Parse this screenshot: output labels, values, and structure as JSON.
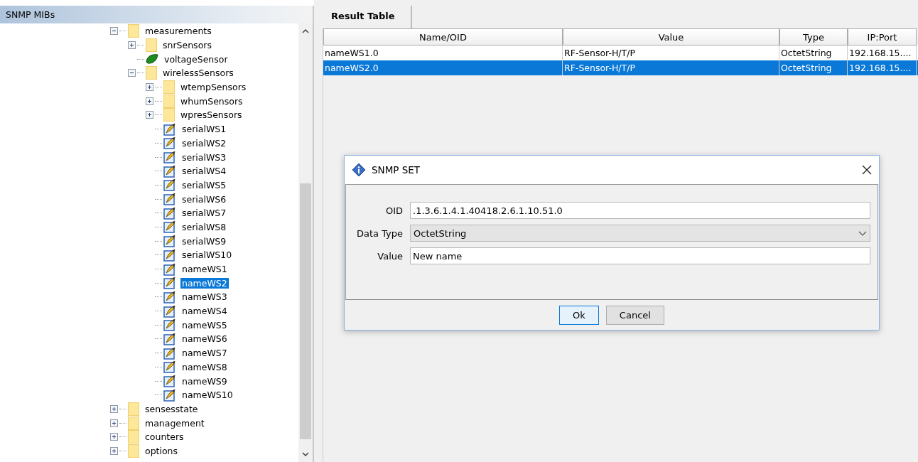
{
  "left_panel": {
    "title": "SNMP MIBs"
  },
  "tree": [
    {
      "label": "measurements",
      "kind": "folder",
      "expanded": true,
      "selected": false,
      "children": [
        {
          "label": "snrSensors",
          "kind": "folder",
          "expanded": false,
          "selected": false
        },
        {
          "label": "voltageSensor",
          "kind": "leaf",
          "selected": false
        },
        {
          "label": "wirelessSensors",
          "kind": "folder",
          "expanded": true,
          "selected": false,
          "children": [
            {
              "label": "wtempSensors",
              "kind": "folder",
              "expanded": false,
              "selected": false
            },
            {
              "label": "whumSensors",
              "kind": "folder",
              "expanded": false,
              "selected": false
            },
            {
              "label": "wpresSensors",
              "kind": "folder",
              "expanded": false,
              "selected": false
            },
            {
              "label": "serialWS1",
              "kind": "scalar",
              "selected": false
            },
            {
              "label": "serialWS2",
              "kind": "scalar",
              "selected": false
            },
            {
              "label": "serialWS3",
              "kind": "scalar",
              "selected": false
            },
            {
              "label": "serialWS4",
              "kind": "scalar",
              "selected": false
            },
            {
              "label": "serialWS5",
              "kind": "scalar",
              "selected": false
            },
            {
              "label": "serialWS6",
              "kind": "scalar",
              "selected": false
            },
            {
              "label": "serialWS7",
              "kind": "scalar",
              "selected": false
            },
            {
              "label": "serialWS8",
              "kind": "scalar",
              "selected": false
            },
            {
              "label": "serialWS9",
              "kind": "scalar",
              "selected": false
            },
            {
              "label": "serialWS10",
              "kind": "scalar",
              "selected": false
            },
            {
              "label": "nameWS1",
              "kind": "scalar",
              "selected": false
            },
            {
              "label": "nameWS2",
              "kind": "scalar",
              "selected": true
            },
            {
              "label": "nameWS3",
              "kind": "scalar",
              "selected": false
            },
            {
              "label": "nameWS4",
              "kind": "scalar",
              "selected": false
            },
            {
              "label": "nameWS5",
              "kind": "scalar",
              "selected": false
            },
            {
              "label": "nameWS6",
              "kind": "scalar",
              "selected": false
            },
            {
              "label": "nameWS7",
              "kind": "scalar",
              "selected": false
            },
            {
              "label": "nameWS8",
              "kind": "scalar",
              "selected": false
            },
            {
              "label": "nameWS9",
              "kind": "scalar",
              "selected": false
            },
            {
              "label": "nameWS10",
              "kind": "scalar",
              "selected": false
            }
          ]
        }
      ]
    },
    {
      "label": "sensesstate",
      "kind": "folder",
      "expanded": false,
      "selected": false
    },
    {
      "label": "management",
      "kind": "folder",
      "expanded": false,
      "selected": false
    },
    {
      "label": "counters",
      "kind": "folder",
      "expanded": false,
      "selected": false
    },
    {
      "label": "options",
      "kind": "folder",
      "expanded": false,
      "selected": false
    }
  ],
  "tabs": [
    {
      "label": "Result Table",
      "selected": true
    }
  ],
  "table": {
    "columns": [
      "Name/OID",
      "Value",
      "Type",
      "IP:Port"
    ],
    "rows": [
      {
        "cells": [
          "nameWS1.0",
          "RF-Sensor-H/T/P",
          "OctetString",
          "192.168.15...."
        ],
        "selected": false
      },
      {
        "cells": [
          "nameWS2.0",
          "RF-Sensor-H/T/P",
          "OctetString",
          "192.168.15...."
        ],
        "selected": true
      }
    ]
  },
  "dialog": {
    "title": "SNMP SET",
    "fields": [
      {
        "label": "OID",
        "kind": "text",
        "value": ".1.3.6.1.4.1.40418.2.6.1.10.51.0"
      },
      {
        "label": "Data Type",
        "kind": "select",
        "value": "OctetString"
      },
      {
        "label": "Value",
        "kind": "text",
        "value": "New name"
      }
    ],
    "buttons": [
      {
        "label": "Ok",
        "default": true
      },
      {
        "label": "Cancel",
        "default": false
      }
    ]
  }
}
